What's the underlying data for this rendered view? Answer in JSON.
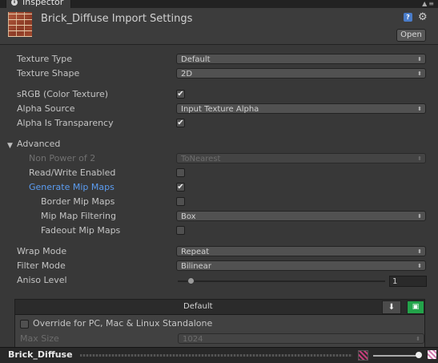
{
  "window": {
    "tab_title": "Inspector",
    "tab_controls": "▲≡"
  },
  "header": {
    "title": "Brick_Diffuse Import Settings",
    "open_label": "Open",
    "help_icon": "help-icon",
    "settings_icon": "gear-icon"
  },
  "fields": {
    "texture_type": {
      "label": "Texture Type",
      "value": "Default"
    },
    "texture_shape": {
      "label": "Texture Shape",
      "value": "2D"
    },
    "srgb": {
      "label": "sRGB (Color Texture)",
      "checked": true
    },
    "alpha_source": {
      "label": "Alpha Source",
      "value": "Input Texture Alpha"
    },
    "alpha_is_transparency": {
      "label": "Alpha Is Transparency",
      "checked": true
    },
    "advanced": {
      "label": "Advanced",
      "expanded": true
    },
    "non_power_of_2": {
      "label": "Non Power of 2",
      "value": "ToNearest"
    },
    "read_write": {
      "label": "Read/Write Enabled",
      "checked": false
    },
    "generate_mip_maps": {
      "label": "Generate Mip Maps",
      "checked": true
    },
    "border_mip_maps": {
      "label": "Border Mip Maps",
      "checked": false
    },
    "mip_map_filtering": {
      "label": "Mip Map Filtering",
      "value": "Box"
    },
    "fadeout_mip_maps": {
      "label": "Fadeout Mip Maps",
      "checked": false
    },
    "wrap_mode": {
      "label": "Wrap Mode",
      "value": "Repeat"
    },
    "filter_mode": {
      "label": "Filter Mode",
      "value": "Bilinear"
    },
    "aniso_level": {
      "label": "Aniso Level",
      "value": "1"
    }
  },
  "platform": {
    "tab_label": "Default",
    "override_label": "Override for PC, Mac & Linux Standalone",
    "override_checked": false,
    "max_size_label": "Max Size",
    "max_size_value": "1024"
  },
  "preview": {
    "title": "Brick_Diffuse"
  },
  "check_glyph": "✔",
  "dropdown_arrow": "⬍",
  "colors": {
    "background": "#383838",
    "highlight_label": "#5b9cf1",
    "windows_badge": "#23a34a"
  }
}
